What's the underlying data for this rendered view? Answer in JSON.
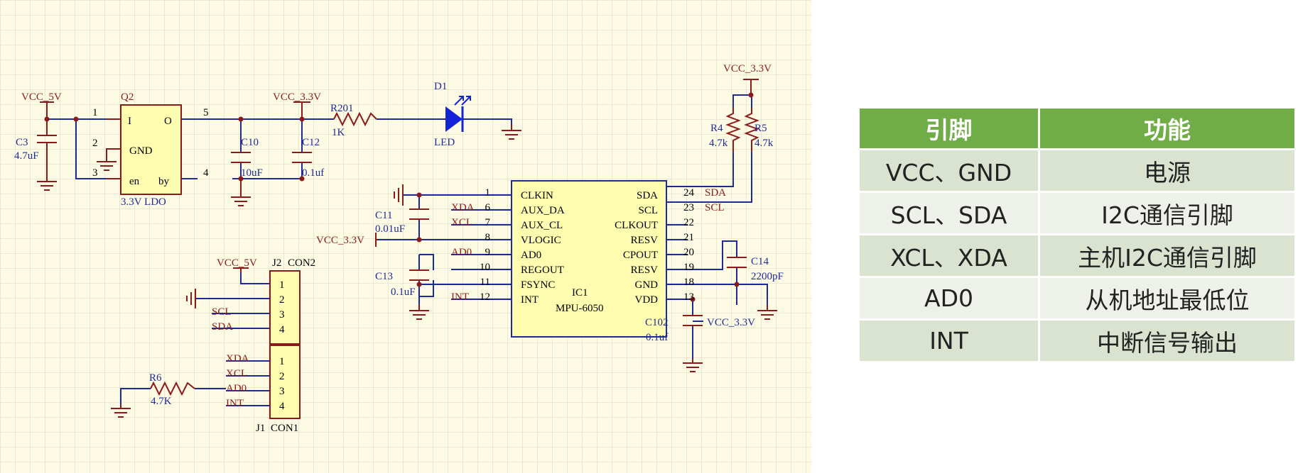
{
  "schematic": {
    "colors": {
      "grid_bg": "#fdfbe4",
      "grid_line": "#d8d8c8",
      "wire": "#1f2a99",
      "part": "#8b1a1a",
      "ic_fill": "#fffdb0",
      "label_blue": "#1f2a99",
      "label_red": "#8b1a1a",
      "led": "#1422d8"
    },
    "net_labels": {
      "vcc5_ldo": "VCC_5V",
      "vcc33_ldo": "VCC_3.3V",
      "vcc33_pullup": "VCC_3.3V",
      "vcc33_vlogic": "VCC_3.3V",
      "vcc33_vdd": "VCC_3.3V",
      "vcc5_j2": "VCC_5V"
    },
    "ldo": {
      "ref": "Q2",
      "value": "3.3V  LDO",
      "pin_i": "I",
      "pin_o": "O",
      "pin_gnd": "GND",
      "pin_en": "en",
      "pin_by": "by",
      "n1": "1",
      "n2": "2",
      "n3": "3",
      "n4": "4",
      "n5": "5"
    },
    "components": {
      "c3_ref": "C3",
      "c3_val": "4.7uF",
      "c10_ref": "C10",
      "c10_val": "10uF",
      "c12_ref": "C12",
      "c12_val": "0.1uf",
      "r201_ref": "R201",
      "r201_val": "1K",
      "d1_ref": "D1",
      "d1_val": "LED",
      "r4_ref": "R4",
      "r4_val": "4.7k",
      "r5_ref": "R5",
      "r5_val": "4.7k",
      "c11_ref": "C11",
      "c11_val": "0.01uF",
      "c13_ref": "C13",
      "c13_val": "0.1uF",
      "c14_ref": "C14",
      "c14_val": "2200pF",
      "c102_ref": "C102",
      "c102_val": "0.1uf",
      "r6_ref": "R6",
      "r6_val": "4.7K"
    },
    "ic": {
      "ref": "IC1",
      "value": "MPU-6050",
      "left_pins": [
        {
          "num": "1",
          "name": "CLKIN",
          "net": ""
        },
        {
          "num": "6",
          "name": "AUX_DA",
          "net": "XDA"
        },
        {
          "num": "7",
          "name": "AUX_CL",
          "net": "XCL"
        },
        {
          "num": "8",
          "name": "VLOGIC",
          "net": ""
        },
        {
          "num": "9",
          "name": "AD0",
          "net": "AD0"
        },
        {
          "num": "10",
          "name": "REGOUT",
          "net": ""
        },
        {
          "num": "11",
          "name": "FSYNC",
          "net": ""
        },
        {
          "num": "12",
          "name": "INT",
          "net": "INT"
        }
      ],
      "right_pins": [
        {
          "num": "24",
          "name": "SDA",
          "net": "SDA"
        },
        {
          "num": "23",
          "name": "SCL",
          "net": "SCL"
        },
        {
          "num": "22",
          "name": "CLKOUT",
          "net": ""
        },
        {
          "num": "21",
          "name": "RESV",
          "net": ""
        },
        {
          "num": "20",
          "name": "CPOUT",
          "net": ""
        },
        {
          "num": "19",
          "name": "RESV",
          "net": ""
        },
        {
          "num": "18",
          "name": "GND",
          "net": ""
        },
        {
          "num": "13",
          "name": "VDD",
          "net": ""
        }
      ]
    },
    "j2": {
      "ref": "J2",
      "value": "CON2",
      "pins": [
        "1",
        "2",
        "3",
        "4"
      ],
      "nets": [
        "",
        "",
        "SCL",
        "SDA"
      ]
    },
    "j1": {
      "ref": "J1",
      "value": "CON1",
      "pins": [
        "1",
        "2",
        "3",
        "4"
      ],
      "nets": [
        "XDA",
        "XCL",
        "AD0",
        "INT"
      ]
    }
  },
  "pin_table": {
    "headers": [
      "引脚",
      "功能"
    ],
    "rows": [
      {
        "pin": "VCC、GND",
        "func": "电源"
      },
      {
        "pin": "SCL、SDA",
        "func": "I2C通信引脚"
      },
      {
        "pin": "XCL、XDA",
        "func": "主机I2C通信引脚"
      },
      {
        "pin": "AD0",
        "func": "从机地址最低位"
      },
      {
        "pin": "INT",
        "func": "中断信号输出"
      }
    ],
    "colors": {
      "header_bg": "#70ad47",
      "row_odd": "#d9e3d0",
      "row_even": "#eef1ea"
    }
  }
}
